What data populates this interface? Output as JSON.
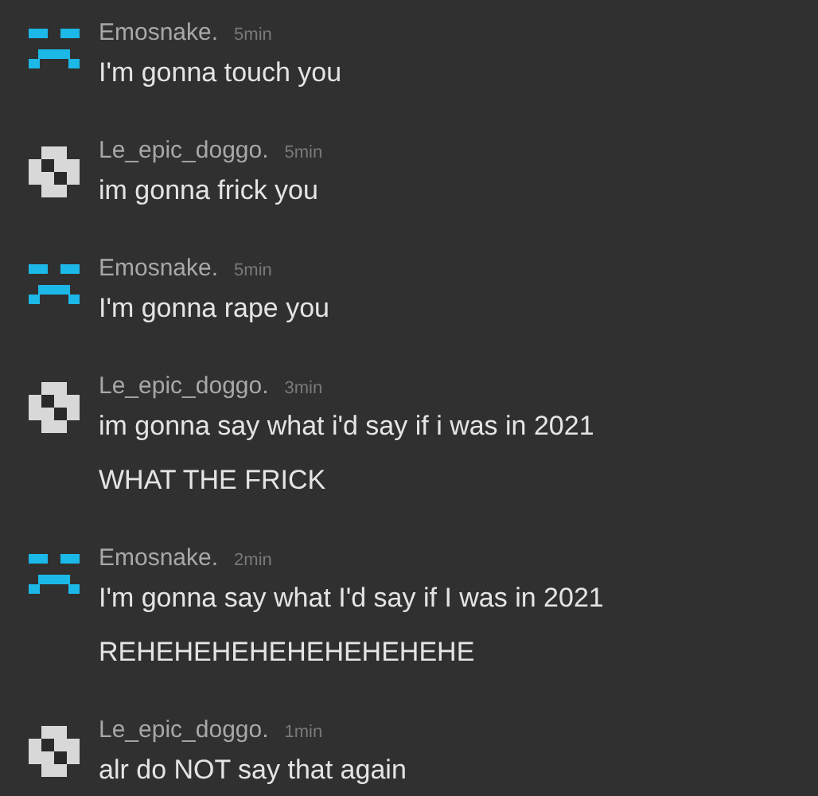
{
  "messages": [
    {
      "kind": "sad-face",
      "author": "Emosnake.",
      "time": "5min",
      "lines": [
        "I'm gonna touch you"
      ]
    },
    {
      "kind": "pixel",
      "author": "Le_epic_doggo.",
      "time": "5min",
      "lines": [
        "im gonna frick you"
      ]
    },
    {
      "kind": "sad-face",
      "author": "Emosnake.",
      "time": "5min",
      "lines": [
        "I'm gonna rape you"
      ]
    },
    {
      "kind": "pixel",
      "author": "Le_epic_doggo.",
      "time": "3min",
      "lines": [
        "im gonna say what i'd say if i was in 2021",
        "WHAT THE FRICK"
      ]
    },
    {
      "kind": "sad-face",
      "author": "Emosnake.",
      "time": "2min",
      "lines": [
        "I'm gonna say what I'd say if I was in 2021",
        "REHEHEHEHEHEHEHEHEHE"
      ]
    },
    {
      "kind": "pixel",
      "author": "Le_epic_doggo.",
      "time": "1min",
      "lines": [
        "alr do NOT say that again"
      ]
    }
  ]
}
